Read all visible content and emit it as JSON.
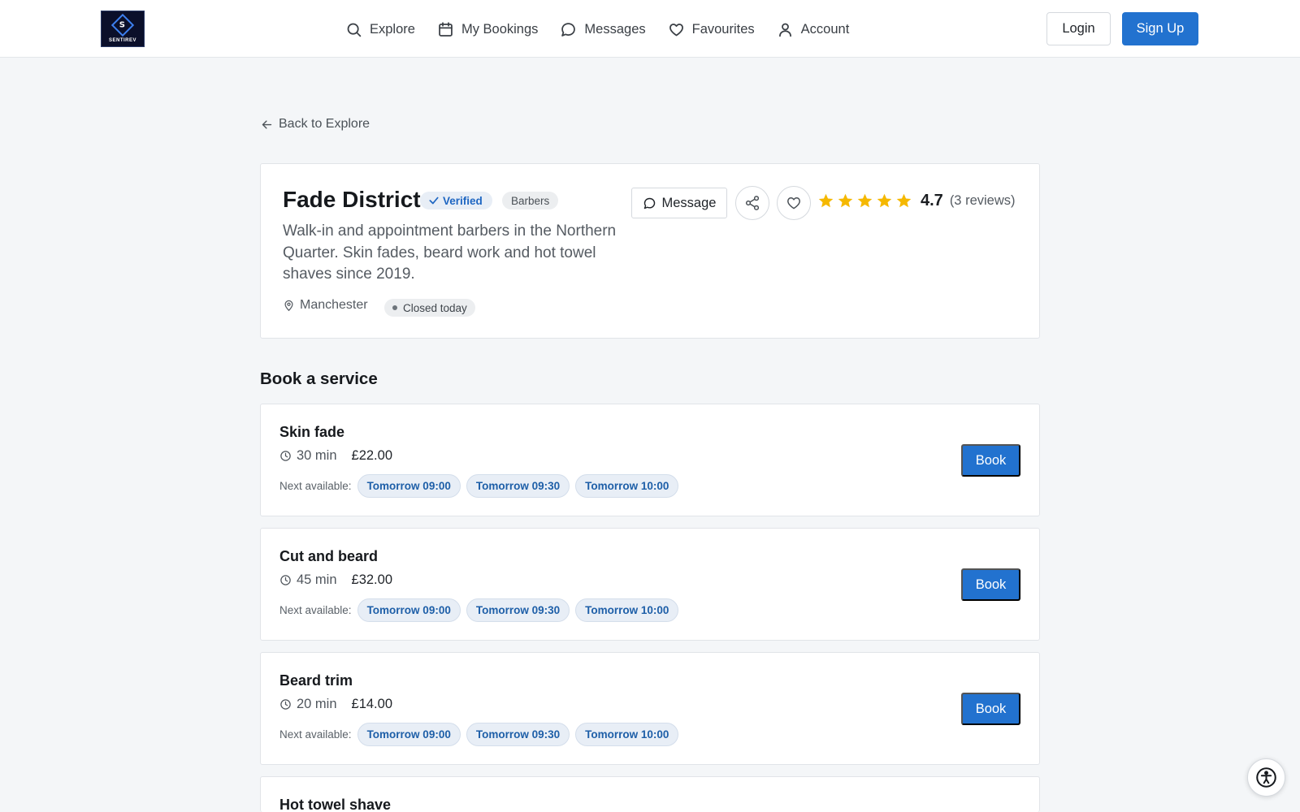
{
  "header": {
    "logo_text": "SENTIREV",
    "logo_letter": "S",
    "nav": [
      {
        "label": "Explore",
        "icon": "search-icon"
      },
      {
        "label": "My Bookings",
        "icon": "calendar-icon"
      },
      {
        "label": "Messages",
        "icon": "message-icon"
      },
      {
        "label": "Favourites",
        "icon": "heart-icon"
      },
      {
        "label": "Account",
        "icon": "user-icon"
      }
    ],
    "login_label": "Login",
    "signup_label": "Sign Up"
  },
  "back_label": "Back to Explore",
  "business": {
    "name": "Fade District",
    "verified_label": "Verified",
    "category": "Barbers",
    "description": "Walk-in and appointment barbers in the Northern Quarter. Skin fades, beard work and hot towel shaves since 2019.",
    "location": "Manchester",
    "status": "Closed today",
    "message_label": "Message",
    "rating": "4.7",
    "rating_stars": 5,
    "reviews": "(3 reviews)"
  },
  "section_title": "Book a service",
  "next_label": "Next available:",
  "book_label": "Book",
  "services": [
    {
      "name": "Skin fade",
      "duration": "30 min",
      "price": "£22.00",
      "slots": [
        "Tomorrow 09:00",
        "Tomorrow 09:30",
        "Tomorrow 10:00"
      ]
    },
    {
      "name": "Cut and beard",
      "duration": "45 min",
      "price": "£32.00",
      "slots": [
        "Tomorrow 09:00",
        "Tomorrow 09:30",
        "Tomorrow 10:00"
      ]
    },
    {
      "name": "Beard trim",
      "duration": "20 min",
      "price": "£14.00",
      "slots": [
        "Tomorrow 09:00",
        "Tomorrow 09:30",
        "Tomorrow 10:00"
      ]
    },
    {
      "name": "Hot towel shave"
    }
  ],
  "colors": {
    "accent": "#2272cf",
    "star": "#f5b800",
    "background": "#f4f6f8"
  }
}
